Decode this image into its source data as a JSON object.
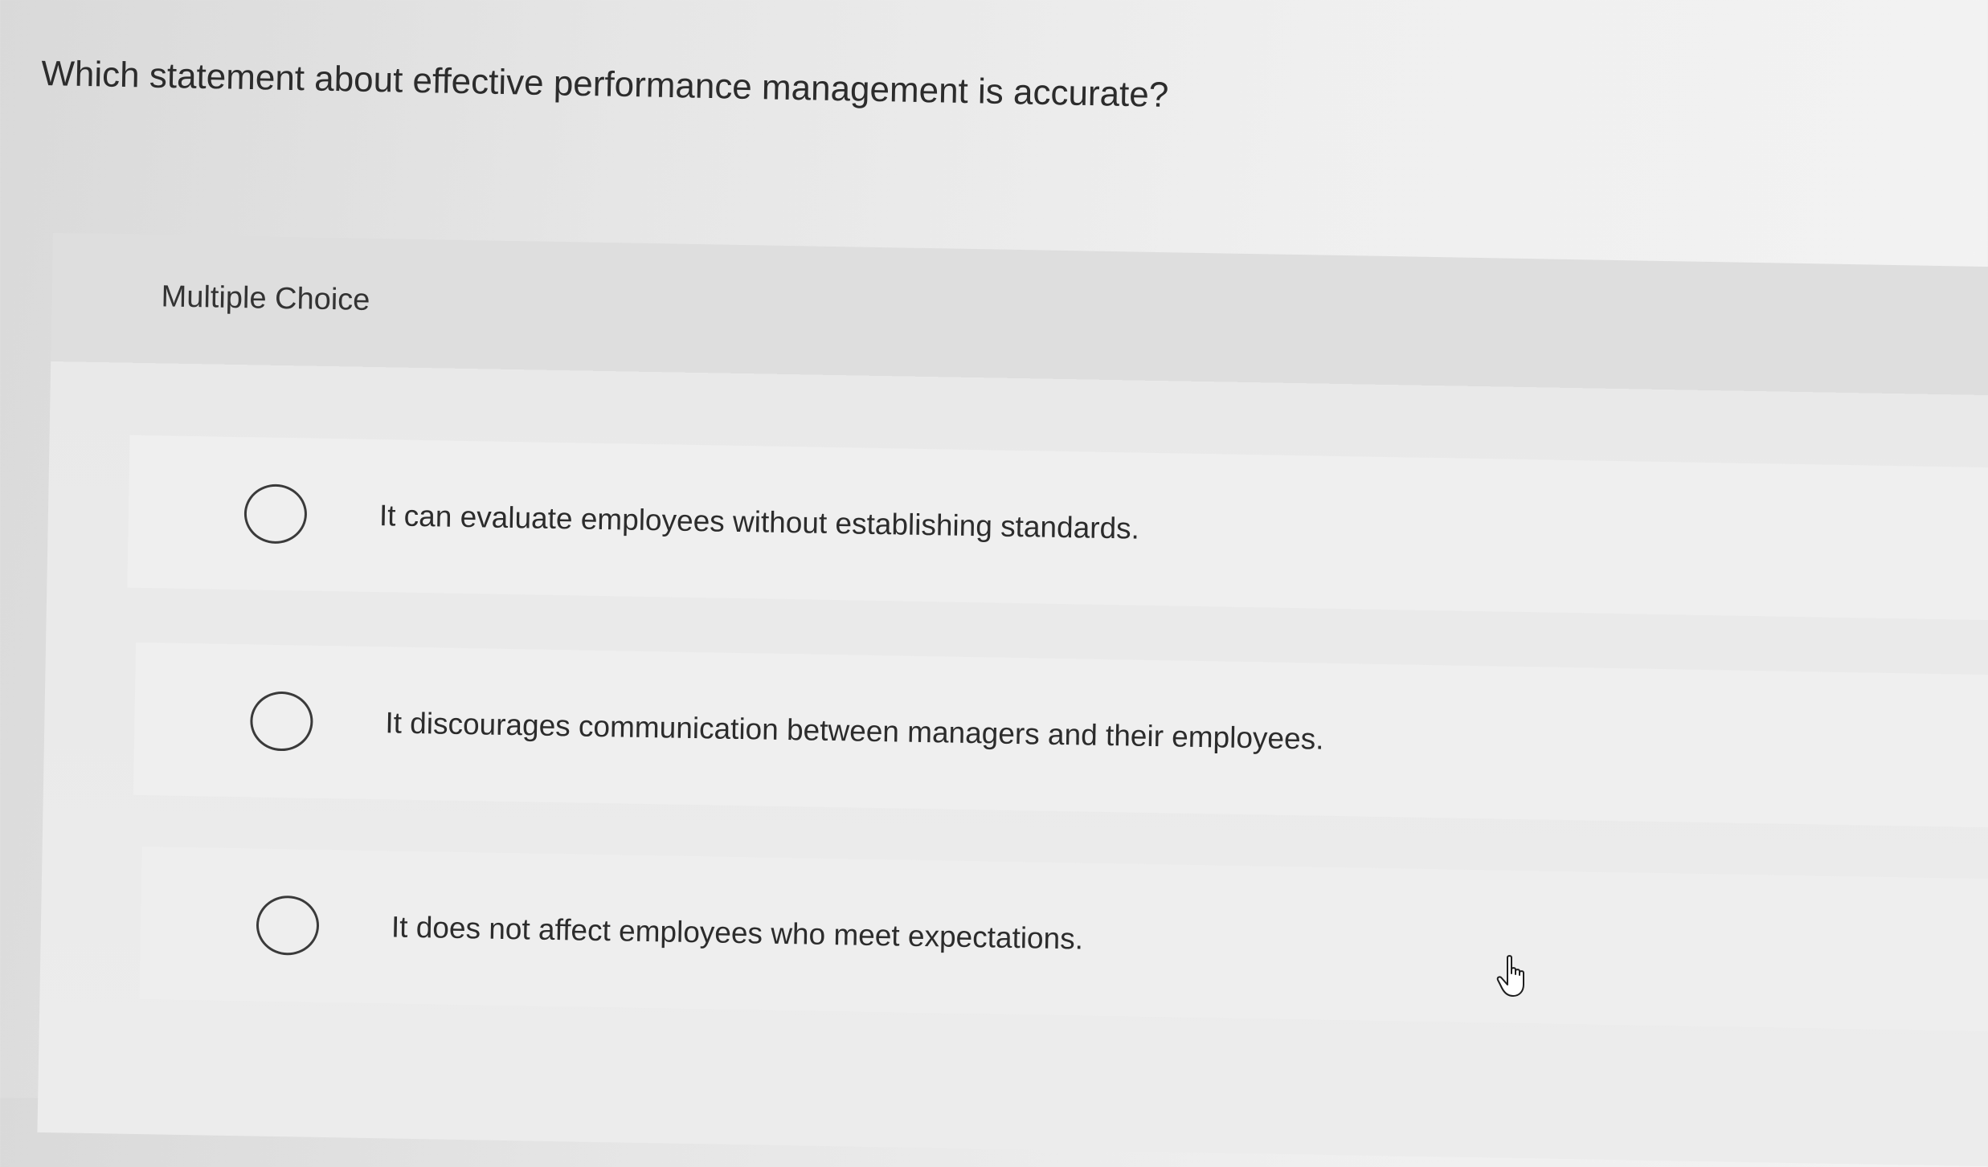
{
  "question": {
    "text": "Which statement about effective performance management is accurate?"
  },
  "panel": {
    "header": "Multiple Choice",
    "options": [
      {
        "label": "It can evaluate employees without establishing standards.",
        "selected": false
      },
      {
        "label": "It discourages communication between managers and their employees.",
        "selected": false
      },
      {
        "label": "It does not affect employees who meet expectations.",
        "selected": false
      }
    ]
  },
  "cursor": {
    "icon": "hand-pointer-icon"
  }
}
